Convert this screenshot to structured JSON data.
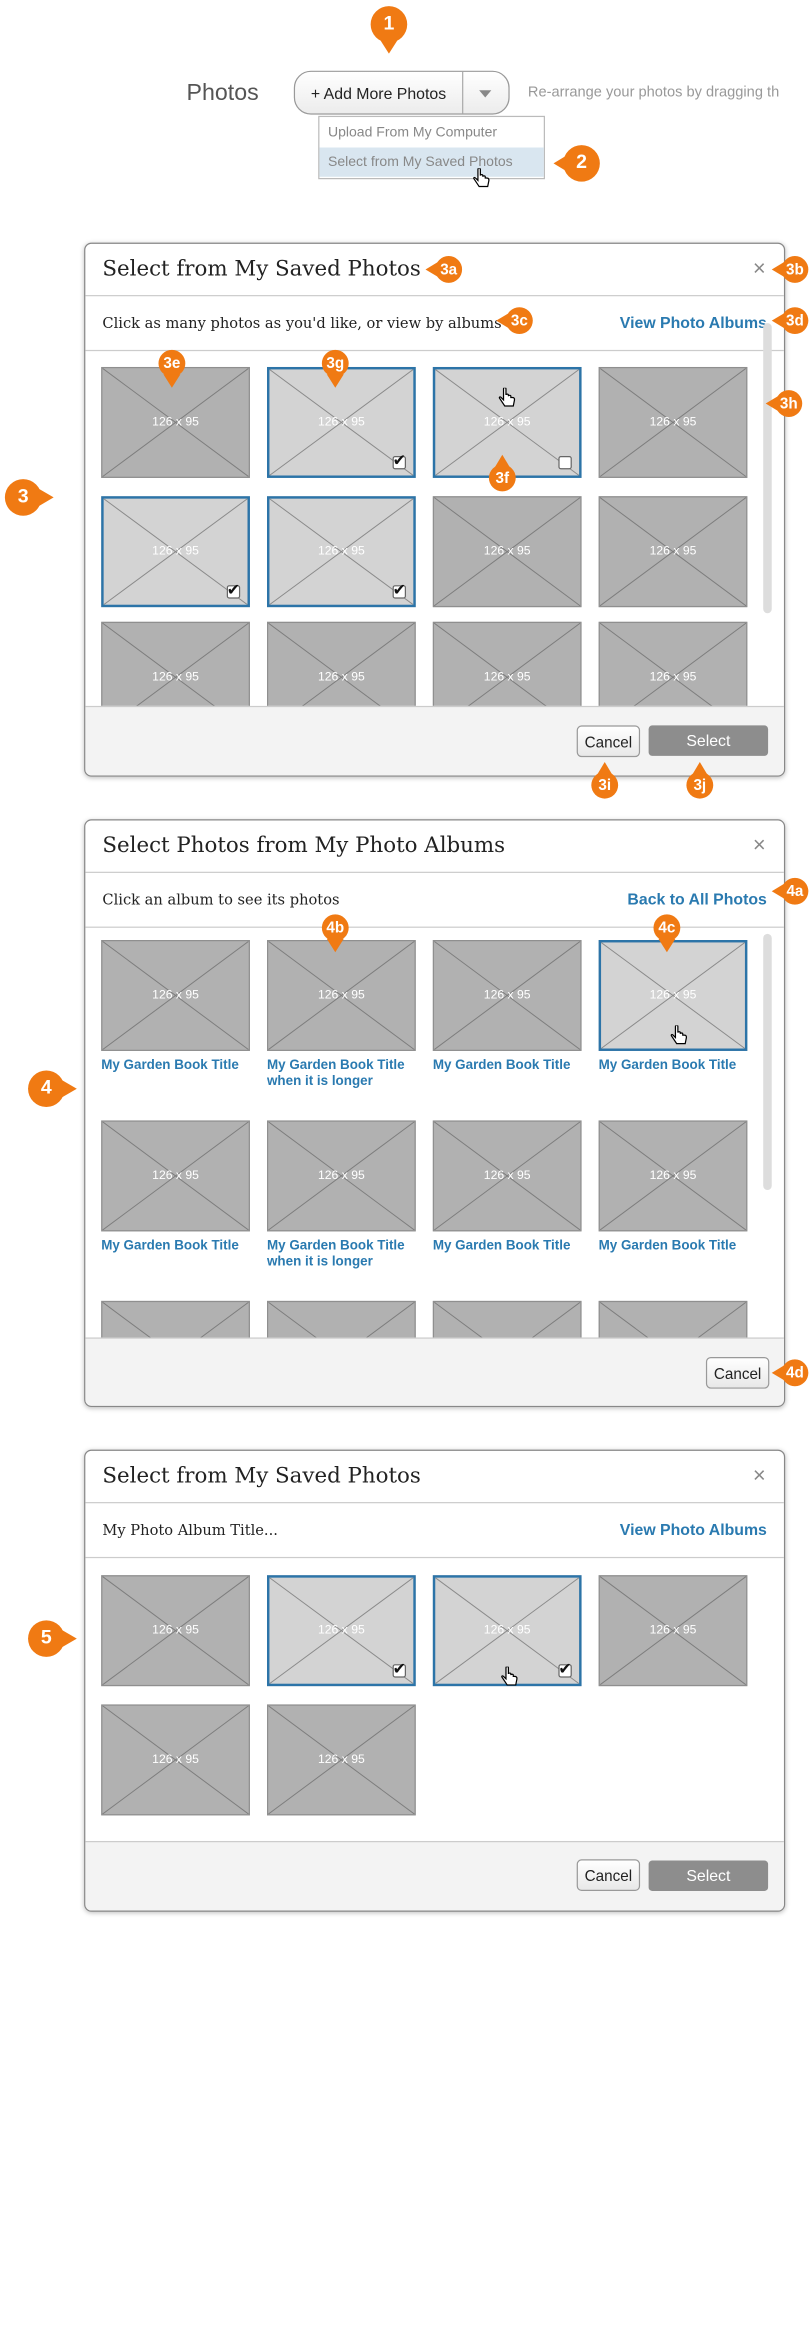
{
  "toolbar": {
    "photos_label": "Photos",
    "add_button_label": "+ Add More Photos",
    "rearrange_hint": "Re-arrange your photos by dragging th",
    "menu": [
      "Upload From My Computer",
      "Select from My Saved Photos"
    ]
  },
  "dialog_saved": {
    "title": "Select from My Saved Photos",
    "close": "×",
    "instruction": "Click as many photos as you'd like, or view by albums",
    "albums_link": "View Photo Albums",
    "cancel_label": "Cancel",
    "select_label": "Select",
    "thumb_size": "126 x 95",
    "selected_flags": [
      false,
      true,
      false,
      false,
      true,
      true,
      false,
      false,
      false,
      false,
      false,
      false
    ]
  },
  "dialog_albums": {
    "title": "Select Photos from My Photo Albums",
    "close": "×",
    "instruction": "Click an album to see its photos",
    "back_link": "Back to All Photos",
    "cancel_label": "Cancel",
    "thumb_size": "126 x 95",
    "albums": [
      "My Garden Book Title",
      "My Garden Book Title when it is longer",
      "My Garden Book Title",
      "My Garden Book Title",
      "My Garden Book Title",
      "My Garden Book Title when it is longer",
      "My Garden Book Title",
      "My Garden Book Title"
    ]
  },
  "dialog_album_view": {
    "title": "Select from My Saved Photos",
    "close": "×",
    "album_title": "My Photo Album Title...",
    "albums_link": "View Photo Albums",
    "cancel_label": "Cancel",
    "select_label": "Select",
    "thumb_size": "126 x 95",
    "selected_flags": [
      false,
      true,
      true,
      false,
      false,
      false
    ]
  },
  "callouts": [
    "1",
    "2",
    "3",
    "3a",
    "3b",
    "3c",
    "3d",
    "3e",
    "3f",
    "3g",
    "3h",
    "3i",
    "3j",
    "4",
    "4a",
    "4b",
    "4c",
    "4d",
    "5"
  ],
  "colors": {
    "accent": "#f07a13",
    "link": "#2a7ab0",
    "selected_border": "#2c74a8",
    "select_button": "#8d8d8d"
  }
}
